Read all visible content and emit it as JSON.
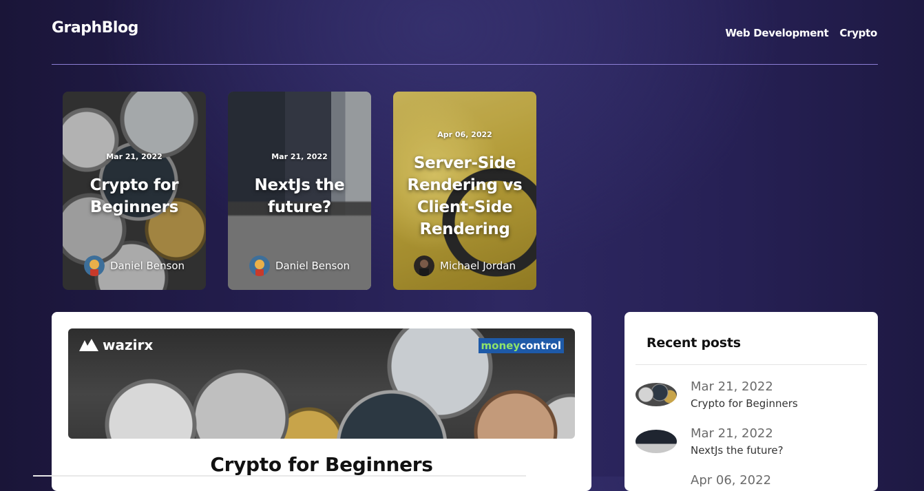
{
  "header": {
    "logo": "GraphBlog",
    "nav": [
      "Web Development",
      "Crypto"
    ]
  },
  "featured": [
    {
      "date": "Mar 21, 2022",
      "title": "Crypto for Beginners",
      "author": "Daniel Benson",
      "image": "crypto-coins"
    },
    {
      "date": "Mar 21, 2022",
      "title": "NextJs the future?",
      "author": "Daniel Benson",
      "image": "laptop-code"
    },
    {
      "date": "Apr 06, 2022",
      "title": "Server-Side Rendering vs Client-Side Rendering",
      "author": "Michael Jordan",
      "image": "headphones"
    }
  ],
  "main_post": {
    "hero_logo_left": "wazirx",
    "hero_logo_right_a": "money",
    "hero_logo_right_b": "control",
    "title": "Crypto for Beginners"
  },
  "sidebar": {
    "heading": "Recent posts",
    "posts": [
      {
        "date": "Mar 21, 2022",
        "title": "Crypto for Beginners"
      },
      {
        "date": "Mar 21, 2022",
        "title": "NextJs the future?"
      }
    ],
    "partial_date": "Apr 06, 2022"
  },
  "colors": {
    "background": "#241e4f",
    "divider": "#8d7fd6",
    "panel": "#ffffff"
  }
}
